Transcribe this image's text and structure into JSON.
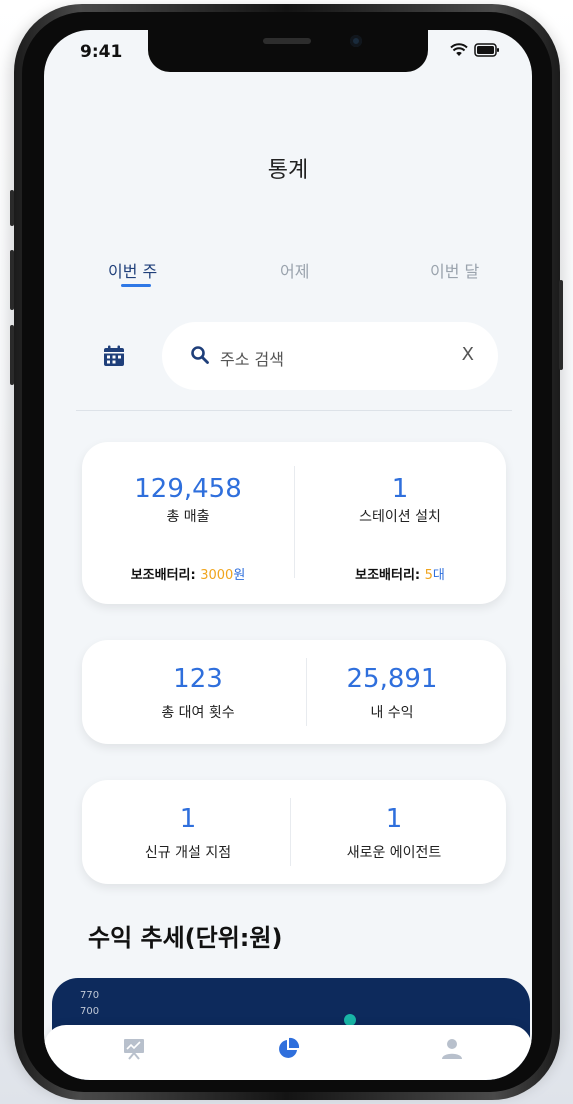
{
  "status_bar": {
    "time": "9:41"
  },
  "header": {
    "title": "통계"
  },
  "tabs": [
    {
      "label": "이번 주",
      "active": true
    },
    {
      "label": "어제",
      "active": false
    },
    {
      "label": "이번 달",
      "active": false
    }
  ],
  "search": {
    "placeholder": "주소 검색",
    "clear_label": "X"
  },
  "stats_card_1": {
    "left": {
      "value": "129,458",
      "label": "총 매출",
      "sub_label": "보조배터리:",
      "sub_value": "3000",
      "sub_unit": "원"
    },
    "right": {
      "value": "1",
      "label": "스테이션 설치",
      "sub_label": "보조배터리:",
      "sub_value": "5",
      "sub_unit": "대"
    }
  },
  "stats_card_2": {
    "left": {
      "value": "123",
      "label": "총 대여 횟수"
    },
    "right": {
      "value": "25,891",
      "label": "내 수익"
    }
  },
  "stats_card_3": {
    "left": {
      "value": "1",
      "label": "신규 개설 지점"
    },
    "right": {
      "value": "1",
      "label": "새로운 에이전트"
    }
  },
  "revenue_section": {
    "title": "수익 추세(단위:원)",
    "y_ticks": [
      "770",
      "700"
    ]
  },
  "bottom_nav": [
    {
      "icon": "chart-presentation-icon",
      "active": false
    },
    {
      "icon": "pie-chart-icon",
      "active": true
    },
    {
      "icon": "user-icon",
      "active": false
    }
  ],
  "colors": {
    "accent": "#2f6fdc",
    "highlight": "#f0a51e",
    "chart_bg": "#0d2a5c",
    "tab_active": "#1f3f7a"
  }
}
